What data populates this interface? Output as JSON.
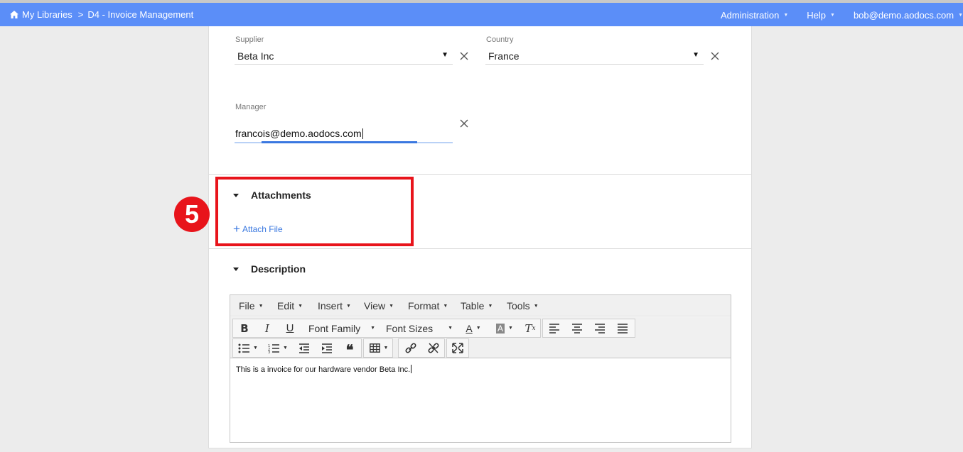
{
  "nav": {
    "breadcrumb_home": "My Libraries",
    "breadcrumb_sep": ">",
    "breadcrumb_current": "D4 - Invoice Management",
    "menus": [
      "Administration",
      "Help",
      "bob@demo.aodocs.com"
    ]
  },
  "form": {
    "supplier_label": "Supplier",
    "supplier_value": "Beta Inc",
    "country_label": "Country",
    "country_value": "France",
    "manager_label": "Manager",
    "manager_value": "francois@demo.aodocs.com"
  },
  "attachments": {
    "title": "Attachments",
    "attach_label": "Attach File"
  },
  "annotation": {
    "step": "5"
  },
  "description": {
    "title": "Description",
    "menus": [
      "File",
      "Edit",
      "Insert",
      "View",
      "Format",
      "Table",
      "Tools"
    ],
    "font_family_label": "Font Family",
    "font_sizes_label": "Font Sizes",
    "content": "This is a invoice for our hardware vendor  Beta Inc."
  },
  "colors": {
    "navbar": "#5b8ef8",
    "accent": "#3a78e0",
    "annotation": "#e8141b"
  }
}
